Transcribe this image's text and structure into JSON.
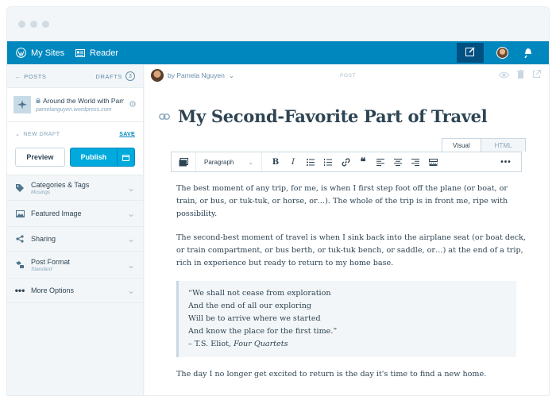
{
  "masterbar": {
    "my_sites": "My Sites",
    "reader": "Reader"
  },
  "sidebar": {
    "posts_label": "POSTS",
    "drafts_label": "DRAFTS",
    "drafts_count": "3",
    "site_title": "Around the World with Pam",
    "site_url": "pamelanguyen.wordpress.com",
    "new_draft": "NEW DRAFT",
    "save": "SAVE",
    "preview": "Preview",
    "publish": "Publish",
    "sections": [
      {
        "label": "Categories & Tags",
        "sub": "Musings",
        "icon": "tag-icon"
      },
      {
        "label": "Featured Image",
        "sub": "",
        "icon": "image-icon"
      },
      {
        "label": "Sharing",
        "sub": "",
        "icon": "share-icon"
      },
      {
        "label": "Post Format",
        "sub": "Standard",
        "icon": "format-icon"
      },
      {
        "label": "More Options",
        "sub": "",
        "icon": "ellipsis-icon"
      }
    ]
  },
  "editor": {
    "author": "by Pamela Nguyen",
    "post_label": "POST",
    "title": "My Second-Favorite Part of Travel",
    "tab_visual": "Visual",
    "tab_html": "HTML",
    "format_select": "Paragraph",
    "paragraphs": [
      "The best moment of any trip, for me, is when I first step foot off the plane (or boat, or train, or bus, or tuk-tuk, or horse, or…). The whole of the trip is in front me, ripe with possibility.",
      "The second-best moment of travel is when I sink back into the airplane seat (or boat deck, or train compartment, or bus berth, or tuk-tuk bench, or saddle, or…) at the end of a trip, rich in experience but ready to return to my home base."
    ],
    "quote_lines": [
      "“We shall not cease from exploration",
      "And the end of all our exploring",
      "Will be to arrive where we started",
      "And know the place for the first time.”"
    ],
    "quote_attrib_prefix": "– T.S. Eliot,",
    "quote_attrib_work": "Four Quartets",
    "closing": "The day I no longer get excited to return is the day it's time to find a new home."
  }
}
